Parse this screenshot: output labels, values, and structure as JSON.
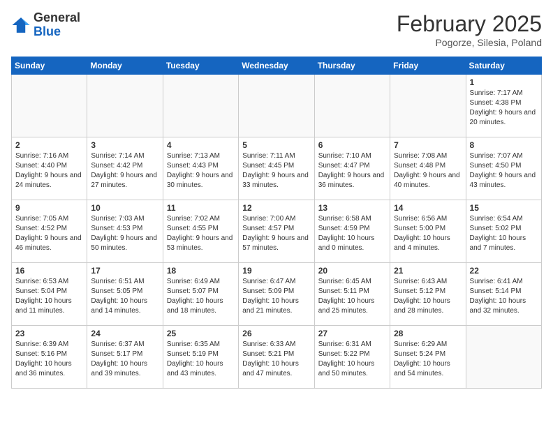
{
  "logo": {
    "general": "General",
    "blue": "Blue"
  },
  "header": {
    "month": "February 2025",
    "location": "Pogorze, Silesia, Poland"
  },
  "weekdays": [
    "Sunday",
    "Monday",
    "Tuesday",
    "Wednesday",
    "Thursday",
    "Friday",
    "Saturday"
  ],
  "weeks": [
    [
      {
        "day": "",
        "info": ""
      },
      {
        "day": "",
        "info": ""
      },
      {
        "day": "",
        "info": ""
      },
      {
        "day": "",
        "info": ""
      },
      {
        "day": "",
        "info": ""
      },
      {
        "day": "",
        "info": ""
      },
      {
        "day": "1",
        "info": "Sunrise: 7:17 AM\nSunset: 4:38 PM\nDaylight: 9 hours and 20 minutes."
      }
    ],
    [
      {
        "day": "2",
        "info": "Sunrise: 7:16 AM\nSunset: 4:40 PM\nDaylight: 9 hours and 24 minutes."
      },
      {
        "day": "3",
        "info": "Sunrise: 7:14 AM\nSunset: 4:42 PM\nDaylight: 9 hours and 27 minutes."
      },
      {
        "day": "4",
        "info": "Sunrise: 7:13 AM\nSunset: 4:43 PM\nDaylight: 9 hours and 30 minutes."
      },
      {
        "day": "5",
        "info": "Sunrise: 7:11 AM\nSunset: 4:45 PM\nDaylight: 9 hours and 33 minutes."
      },
      {
        "day": "6",
        "info": "Sunrise: 7:10 AM\nSunset: 4:47 PM\nDaylight: 9 hours and 36 minutes."
      },
      {
        "day": "7",
        "info": "Sunrise: 7:08 AM\nSunset: 4:48 PM\nDaylight: 9 hours and 40 minutes."
      },
      {
        "day": "8",
        "info": "Sunrise: 7:07 AM\nSunset: 4:50 PM\nDaylight: 9 hours and 43 minutes."
      }
    ],
    [
      {
        "day": "9",
        "info": "Sunrise: 7:05 AM\nSunset: 4:52 PM\nDaylight: 9 hours and 46 minutes."
      },
      {
        "day": "10",
        "info": "Sunrise: 7:03 AM\nSunset: 4:53 PM\nDaylight: 9 hours and 50 minutes."
      },
      {
        "day": "11",
        "info": "Sunrise: 7:02 AM\nSunset: 4:55 PM\nDaylight: 9 hours and 53 minutes."
      },
      {
        "day": "12",
        "info": "Sunrise: 7:00 AM\nSunset: 4:57 PM\nDaylight: 9 hours and 57 minutes."
      },
      {
        "day": "13",
        "info": "Sunrise: 6:58 AM\nSunset: 4:59 PM\nDaylight: 10 hours and 0 minutes."
      },
      {
        "day": "14",
        "info": "Sunrise: 6:56 AM\nSunset: 5:00 PM\nDaylight: 10 hours and 4 minutes."
      },
      {
        "day": "15",
        "info": "Sunrise: 6:54 AM\nSunset: 5:02 PM\nDaylight: 10 hours and 7 minutes."
      }
    ],
    [
      {
        "day": "16",
        "info": "Sunrise: 6:53 AM\nSunset: 5:04 PM\nDaylight: 10 hours and 11 minutes."
      },
      {
        "day": "17",
        "info": "Sunrise: 6:51 AM\nSunset: 5:05 PM\nDaylight: 10 hours and 14 minutes."
      },
      {
        "day": "18",
        "info": "Sunrise: 6:49 AM\nSunset: 5:07 PM\nDaylight: 10 hours and 18 minutes."
      },
      {
        "day": "19",
        "info": "Sunrise: 6:47 AM\nSunset: 5:09 PM\nDaylight: 10 hours and 21 minutes."
      },
      {
        "day": "20",
        "info": "Sunrise: 6:45 AM\nSunset: 5:11 PM\nDaylight: 10 hours and 25 minutes."
      },
      {
        "day": "21",
        "info": "Sunrise: 6:43 AM\nSunset: 5:12 PM\nDaylight: 10 hours and 28 minutes."
      },
      {
        "day": "22",
        "info": "Sunrise: 6:41 AM\nSunset: 5:14 PM\nDaylight: 10 hours and 32 minutes."
      }
    ],
    [
      {
        "day": "23",
        "info": "Sunrise: 6:39 AM\nSunset: 5:16 PM\nDaylight: 10 hours and 36 minutes."
      },
      {
        "day": "24",
        "info": "Sunrise: 6:37 AM\nSunset: 5:17 PM\nDaylight: 10 hours and 39 minutes."
      },
      {
        "day": "25",
        "info": "Sunrise: 6:35 AM\nSunset: 5:19 PM\nDaylight: 10 hours and 43 minutes."
      },
      {
        "day": "26",
        "info": "Sunrise: 6:33 AM\nSunset: 5:21 PM\nDaylight: 10 hours and 47 minutes."
      },
      {
        "day": "27",
        "info": "Sunrise: 6:31 AM\nSunset: 5:22 PM\nDaylight: 10 hours and 50 minutes."
      },
      {
        "day": "28",
        "info": "Sunrise: 6:29 AM\nSunset: 5:24 PM\nDaylight: 10 hours and 54 minutes."
      },
      {
        "day": "",
        "info": ""
      }
    ]
  ]
}
